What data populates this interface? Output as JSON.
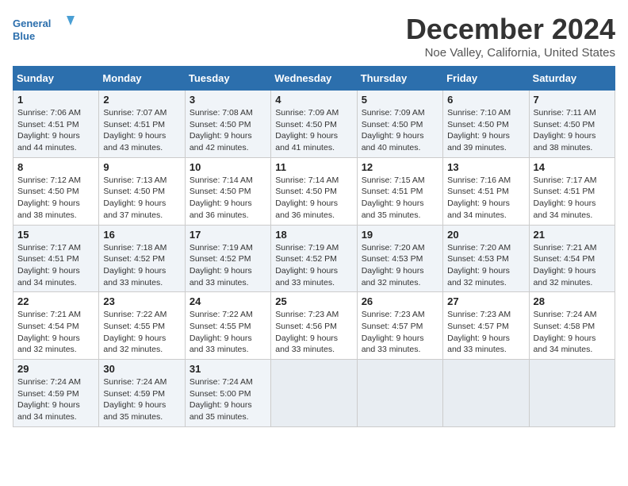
{
  "logo": {
    "brand": "General",
    "brand2": "Blue"
  },
  "title": "December 2024",
  "subtitle": "Noe Valley, California, United States",
  "header": {
    "days": [
      "Sunday",
      "Monday",
      "Tuesday",
      "Wednesday",
      "Thursday",
      "Friday",
      "Saturday"
    ]
  },
  "weeks": [
    [
      {
        "day": "1",
        "sunrise": "7:06 AM",
        "sunset": "4:51 PM",
        "daylight": "9 hours and 44 minutes."
      },
      {
        "day": "2",
        "sunrise": "7:07 AM",
        "sunset": "4:51 PM",
        "daylight": "9 hours and 43 minutes."
      },
      {
        "day": "3",
        "sunrise": "7:08 AM",
        "sunset": "4:50 PM",
        "daylight": "9 hours and 42 minutes."
      },
      {
        "day": "4",
        "sunrise": "7:09 AM",
        "sunset": "4:50 PM",
        "daylight": "9 hours and 41 minutes."
      },
      {
        "day": "5",
        "sunrise": "7:09 AM",
        "sunset": "4:50 PM",
        "daylight": "9 hours and 40 minutes."
      },
      {
        "day": "6",
        "sunrise": "7:10 AM",
        "sunset": "4:50 PM",
        "daylight": "9 hours and 39 minutes."
      },
      {
        "day": "7",
        "sunrise": "7:11 AM",
        "sunset": "4:50 PM",
        "daylight": "9 hours and 38 minutes."
      }
    ],
    [
      {
        "day": "8",
        "sunrise": "7:12 AM",
        "sunset": "4:50 PM",
        "daylight": "9 hours and 38 minutes."
      },
      {
        "day": "9",
        "sunrise": "7:13 AM",
        "sunset": "4:50 PM",
        "daylight": "9 hours and 37 minutes."
      },
      {
        "day": "10",
        "sunrise": "7:14 AM",
        "sunset": "4:50 PM",
        "daylight": "9 hours and 36 minutes."
      },
      {
        "day": "11",
        "sunrise": "7:14 AM",
        "sunset": "4:50 PM",
        "daylight": "9 hours and 36 minutes."
      },
      {
        "day": "12",
        "sunrise": "7:15 AM",
        "sunset": "4:51 PM",
        "daylight": "9 hours and 35 minutes."
      },
      {
        "day": "13",
        "sunrise": "7:16 AM",
        "sunset": "4:51 PM",
        "daylight": "9 hours and 34 minutes."
      },
      {
        "day": "14",
        "sunrise": "7:17 AM",
        "sunset": "4:51 PM",
        "daylight": "9 hours and 34 minutes."
      }
    ],
    [
      {
        "day": "15",
        "sunrise": "7:17 AM",
        "sunset": "4:51 PM",
        "daylight": "9 hours and 34 minutes."
      },
      {
        "day": "16",
        "sunrise": "7:18 AM",
        "sunset": "4:52 PM",
        "daylight": "9 hours and 33 minutes."
      },
      {
        "day": "17",
        "sunrise": "7:19 AM",
        "sunset": "4:52 PM",
        "daylight": "9 hours and 33 minutes."
      },
      {
        "day": "18",
        "sunrise": "7:19 AM",
        "sunset": "4:52 PM",
        "daylight": "9 hours and 33 minutes."
      },
      {
        "day": "19",
        "sunrise": "7:20 AM",
        "sunset": "4:53 PM",
        "daylight": "9 hours and 32 minutes."
      },
      {
        "day": "20",
        "sunrise": "7:20 AM",
        "sunset": "4:53 PM",
        "daylight": "9 hours and 32 minutes."
      },
      {
        "day": "21",
        "sunrise": "7:21 AM",
        "sunset": "4:54 PM",
        "daylight": "9 hours and 32 minutes."
      }
    ],
    [
      {
        "day": "22",
        "sunrise": "7:21 AM",
        "sunset": "4:54 PM",
        "daylight": "9 hours and 32 minutes."
      },
      {
        "day": "23",
        "sunrise": "7:22 AM",
        "sunset": "4:55 PM",
        "daylight": "9 hours and 32 minutes."
      },
      {
        "day": "24",
        "sunrise": "7:22 AM",
        "sunset": "4:55 PM",
        "daylight": "9 hours and 33 minutes."
      },
      {
        "day": "25",
        "sunrise": "7:23 AM",
        "sunset": "4:56 PM",
        "daylight": "9 hours and 33 minutes."
      },
      {
        "day": "26",
        "sunrise": "7:23 AM",
        "sunset": "4:57 PM",
        "daylight": "9 hours and 33 minutes."
      },
      {
        "day": "27",
        "sunrise": "7:23 AM",
        "sunset": "4:57 PM",
        "daylight": "9 hours and 33 minutes."
      },
      {
        "day": "28",
        "sunrise": "7:24 AM",
        "sunset": "4:58 PM",
        "daylight": "9 hours and 34 minutes."
      }
    ],
    [
      {
        "day": "29",
        "sunrise": "7:24 AM",
        "sunset": "4:59 PM",
        "daylight": "9 hours and 34 minutes."
      },
      {
        "day": "30",
        "sunrise": "7:24 AM",
        "sunset": "4:59 PM",
        "daylight": "9 hours and 35 minutes."
      },
      {
        "day": "31",
        "sunrise": "7:24 AM",
        "sunset": "5:00 PM",
        "daylight": "9 hours and 35 minutes."
      },
      null,
      null,
      null,
      null
    ]
  ]
}
